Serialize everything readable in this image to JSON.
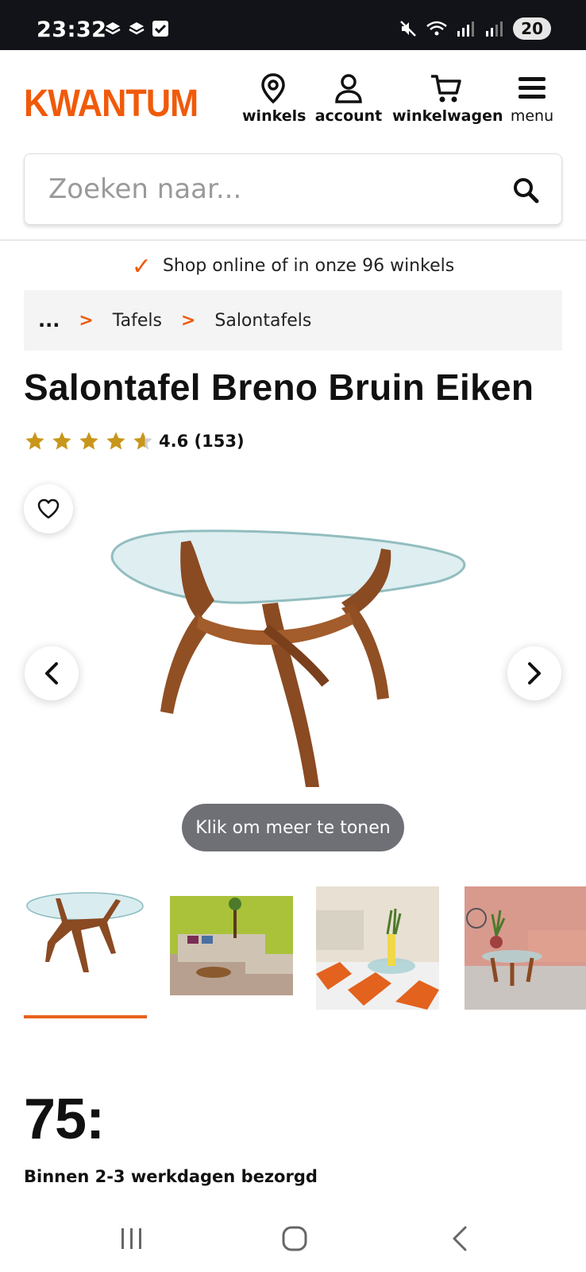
{
  "status_bar": {
    "time": "23:32",
    "battery": "20",
    "icons_left": [
      "notification-icon",
      "notification-icon",
      "check-square-icon"
    ],
    "icons_right": [
      "mute-icon",
      "wifi-icon",
      "signal-icon",
      "signal-icon"
    ]
  },
  "header": {
    "logo": "KWANTUM",
    "nav": {
      "stores": "winkels",
      "account": "account",
      "cart": "winkelwagen",
      "menu": "menu"
    }
  },
  "search": {
    "placeholder": "Zoeken naar..."
  },
  "usp": {
    "text": "Shop online of in onze 96 winkels"
  },
  "breadcrumb": {
    "ellipsis": "...",
    "items": [
      "Tafels",
      "Salontafels"
    ]
  },
  "product": {
    "title": "Salontafel Breno Bruin Eiken",
    "rating_value": 4.6,
    "rating_text": "4.6 (153)",
    "more_label": "Klik om meer te tonen",
    "price": "75:",
    "delivery": "Binnen 2-3 werkdagen bezorgd",
    "selected_thumbnail": 1,
    "thumbnail_count": 4
  },
  "colors": {
    "brand_orange": "#f05a0a",
    "star_gold": "#c8961a",
    "pill_gray": "#6e7076"
  }
}
